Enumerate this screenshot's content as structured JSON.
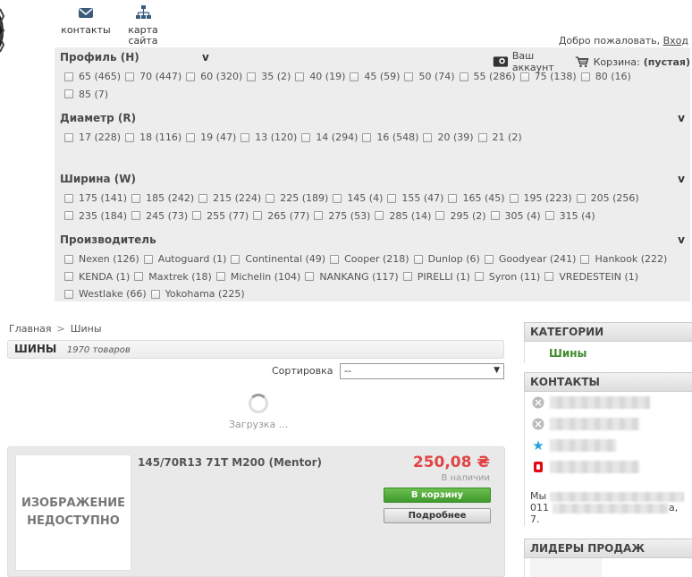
{
  "header": {
    "links": [
      {
        "label": "контакты",
        "icon": "envelope-icon"
      },
      {
        "label": "карта сайта",
        "icon": "sitemap-icon"
      }
    ],
    "welcome": "Добро пожаловать,",
    "login": "Вход",
    "account": "Ваш аккаунт",
    "cart_label": "Корзина:",
    "cart_value": "(пустая)"
  },
  "filters": {
    "profile": {
      "title": "Профиль (H)",
      "toggle": "v",
      "options": [
        "65 (465)",
        "70 (447)",
        "60 (320)",
        "35 (2)",
        "40 (19)",
        "45 (59)",
        "50 (74)",
        "55 (286)",
        "75 (138)",
        "80 (16)",
        "85 (7)"
      ]
    },
    "diameter": {
      "title": "Диаметр (R)",
      "toggle": "v",
      "options": [
        "17 (228)",
        "18 (116)",
        "19 (47)",
        "13 (120)",
        "14 (294)",
        "16 (548)",
        "20 (39)",
        "21 (2)"
      ]
    },
    "width": {
      "title": "Ширина (W)",
      "toggle": "v",
      "options": [
        "175 (141)",
        "185 (242)",
        "215 (224)",
        "225 (189)",
        "145 (4)",
        "155 (47)",
        "165 (45)",
        "195 (223)",
        "205 (256)",
        "235 (184)",
        "245 (73)",
        "255 (77)",
        "265 (77)",
        "275 (53)",
        "285 (14)",
        "295 (2)",
        "305 (4)",
        "315 (4)"
      ]
    },
    "brand": {
      "title": "Производитель",
      "toggle": "v",
      "options": [
        "Nexen (126)",
        "Autoguard (1)",
        "Continental (49)",
        "Cooper (218)",
        "Dunlop (6)",
        "Goodyear (241)",
        "Hankook (222)",
        "KENDA (1)",
        "Maxtrek (18)",
        "Michelin (104)",
        "NANKANG (117)",
        "PIRELLI (1)",
        "Syron (11)",
        "VREDESTEIN (1)",
        "Westlake (66)",
        "Yokohama (225)"
      ]
    }
  },
  "breadcrumb": {
    "home": "Главная",
    "sep": ">",
    "current": "Шины"
  },
  "category": {
    "title": "ШИНЫ",
    "count": "1970 товаров"
  },
  "sort": {
    "label": "Сортировка",
    "value": "--"
  },
  "loading": "Загрузка ...",
  "product": {
    "image_text": "ИЗОБРАЖЕНИЕ НЕДОСТУПНО",
    "name": "145/70R13 71T M200 (Mentor)",
    "price": "250,08 ₴",
    "stock": "В наличии",
    "cart_button": "В корзину",
    "details_button": "Подробнее"
  },
  "sidebar": {
    "categories_title": "КАТЕГОРИИ",
    "category_link": "Шины",
    "contacts_title": "КОНТАКТЫ",
    "address_prefix": "Мы",
    "address_line2": "011",
    "address_line3": "7.",
    "address_tail": "а,",
    "leaders_title": "ЛИДЕРЫ ПРОДАЖ"
  },
  "colors": {
    "accent_green": "#3e8c2f",
    "price_red": "#e04444",
    "panel_bg": "#ededed"
  }
}
